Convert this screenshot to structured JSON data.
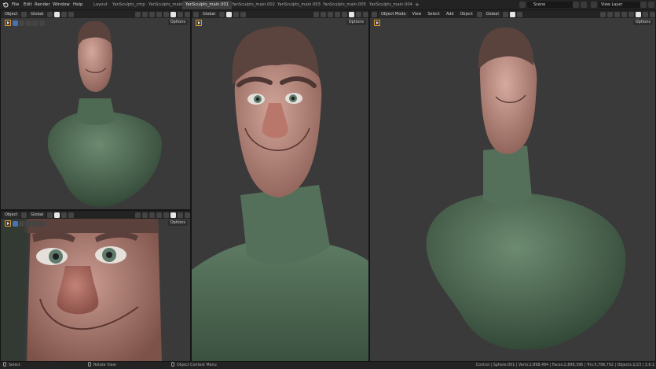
{
  "topbar": {
    "menus": [
      "File",
      "Edit",
      "Render",
      "Window",
      "Help"
    ],
    "tabs": [
      "Layout",
      "YanSculpts_cmp",
      "YanSculpts_main",
      "YanSculpts_main.001",
      "YanSculpts_main.002",
      "YanSculpts_main.003",
      "YanSculpts_main.005",
      "YanSculpts_main.004"
    ],
    "active_tab": "YanSculpts_main.001",
    "add_tab": "+",
    "scene_label": "Scene",
    "view_layer_label": "View Layer"
  },
  "viewports": {
    "top_left": {
      "mode": "Object",
      "orientation": "Global",
      "options": "Options"
    },
    "bottom_left": {
      "mode": "Object",
      "orientation": "Global",
      "options": "Options"
    },
    "middle": {
      "orientation": "Global",
      "options": "Options"
    },
    "right": {
      "mode": "Object Mode",
      "menus": [
        "View",
        "Select",
        "Add",
        "Object"
      ],
      "orientation": "Global",
      "options": "Options"
    }
  },
  "statusbar": {
    "select": "Select",
    "rotate": "Rotate View",
    "context": "Object Context Menu",
    "stats": "Control | Sphere.001 | Verts:2,898,484 | Faces:2,898,396 | Tris:5,796,792 | Objects:1/23 | 3.6.1"
  },
  "colors": {
    "accent_blue": "#4772b3",
    "sweater": "#4f6a54",
    "skin": "#b98c82",
    "hair": "#5c4440",
    "background": "#3a3a3a"
  }
}
